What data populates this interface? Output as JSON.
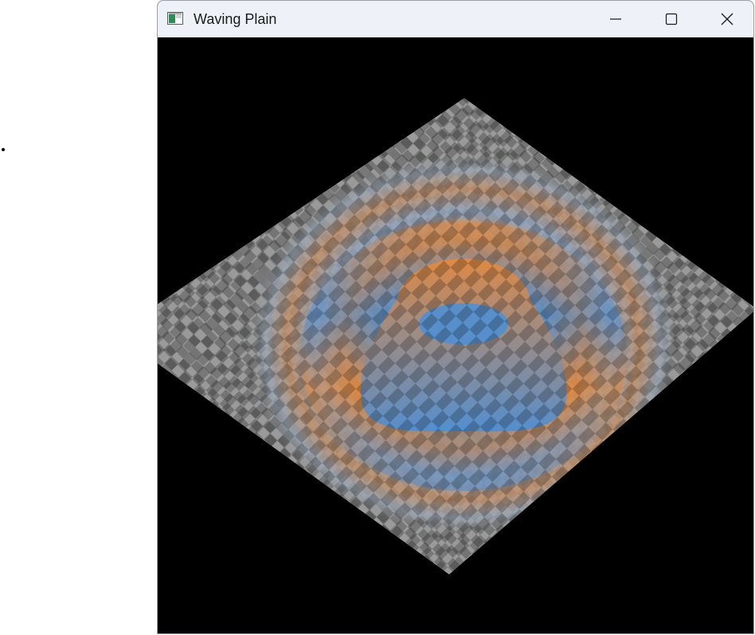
{
  "window": {
    "title": "Waving Plain"
  },
  "icons": {
    "app": "app-window-icon",
    "minimize": "minimize-icon",
    "maximize": "maximize-icon",
    "close": "close-icon"
  },
  "colors": {
    "titlebar": "#eef2f8",
    "viewport_background": "#000000",
    "checker_dark": "#7a7a7a",
    "checker_light": "#9e9e9e",
    "wave_blue": "#4a8fd8",
    "wave_orange": "#e8893a"
  }
}
